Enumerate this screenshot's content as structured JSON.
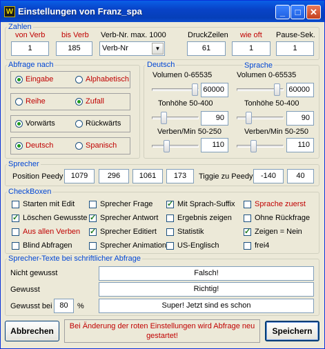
{
  "window": {
    "title": "Einstellungen von Franz_spa",
    "app_icon": "W"
  },
  "zahlen": {
    "legend": "Zahlen",
    "von_label": "von Verb",
    "von_value": "1",
    "bis_label": "bis Verb",
    "bis_value": "185",
    "verbnr_label": "Verb-Nr. max. 1000",
    "verbnr_value": "Verb-Nr",
    "druck_label": "DruckZeilen",
    "druck_value": "61",
    "wie_label": "wie oft",
    "wie_value": "1",
    "pause_label": "Pause-Sek.",
    "pause_value": "1"
  },
  "abfrage": {
    "legend": "Abfrage nach",
    "rows": [
      [
        "Eingabe",
        "Alphabetisch"
      ],
      [
        "Reihe",
        "Zufall"
      ],
      [
        "Vorwärts",
        "Rückwärts"
      ],
      [
        "Deutsch",
        "Spanisch"
      ]
    ]
  },
  "voice": {
    "deutsch": "Deutsch",
    "sprache": "Sprache",
    "vol_label": "Volumen 0-65535",
    "vol_de": "60000",
    "vol_sp": "60000",
    "ton_label": "Tonhöhe 50-400",
    "ton_de": "90",
    "ton_sp": "90",
    "verben_label": "Verben/Min 50-250",
    "verben_de": "110",
    "verben_sp": "110"
  },
  "sprecher": {
    "legend": "Sprecher",
    "pos_label": "Position Peedy",
    "pos": [
      "1079",
      "296",
      "1061",
      "173"
    ],
    "tiggie_label": "Tiggie zu Peedy",
    "tiggie": [
      "-140",
      "40"
    ]
  },
  "checkboxen": {
    "legend": "CheckBoxen",
    "items": [
      [
        "Starten mit Edit",
        "Sprecher Frage",
        "Mit Sprach-Suffix",
        "Sprache zuerst"
      ],
      [
        "Löschen Gewusste",
        "Sprecher Antwort",
        "Ergebnis zeigen",
        "Ohne Rückfrage"
      ],
      [
        "Aus allen Verben",
        "Sprecher Editiert",
        "Statistik",
        "Zeigen = Nein"
      ],
      [
        "Blind Abfragen",
        "Sprecher Animation",
        "US-Englisch",
        "frei4"
      ]
    ]
  },
  "texte": {
    "legend": "Sprecher-Texte bei schriftlicher Abfrage",
    "nicht_label": "Nicht gewusst",
    "nicht_value": "Falsch!",
    "gewusst_label": "Gewusst",
    "gewusst_value": "Richtig!",
    "bei_label": "Gewusst bei",
    "bei_value": "80",
    "percent": "%",
    "bei_text": "Super! Jetzt sind es schon"
  },
  "footer": {
    "abbrechen": "Abbrechen",
    "notice": "Bei Änderung der roten Einstellungen wird Abfrage neu gestartet!",
    "speichern": "Speichern"
  }
}
